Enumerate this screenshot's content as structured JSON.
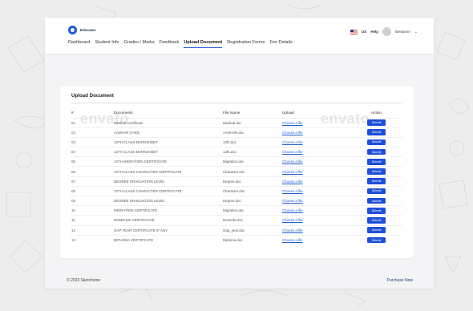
{
  "brand": {
    "name": "Educator"
  },
  "nav": {
    "tabs": [
      {
        "label": "Dashboard",
        "active": false
      },
      {
        "label": "Student Info",
        "active": false
      },
      {
        "label": "Grades / Marks",
        "active": false
      },
      {
        "label": "Feedback",
        "active": false
      },
      {
        "label": "Upload Document",
        "active": true
      },
      {
        "label": "Registration Forms",
        "active": false
      },
      {
        "label": "Fee Details",
        "active": false
      }
    ]
  },
  "topright": {
    "lang": "US",
    "help": "Help",
    "user": "Benjamin"
  },
  "card": {
    "title": "Upload Document",
    "headers": {
      "num": "#",
      "doc": "Documents",
      "file": "File Name",
      "upload": "Upload",
      "action": "Action"
    },
    "rows": [
      {
        "num": "01",
        "doc": "Medical Certificate",
        "file": "Medical.doc",
        "upload": "Choose a file",
        "action": "Submit"
      },
      {
        "num": "02",
        "doc": "AADHAR CARD",
        "file": "AADHAR.doc",
        "upload": "Choose a file",
        "action": "Submit"
      },
      {
        "num": "03",
        "doc": "10TH CLASS MARKSHEET",
        "file": "10th.doc",
        "upload": "Choose a file",
        "action": "Submit"
      },
      {
        "num": "04",
        "doc": "12TH CLASS MARKSHEET",
        "file": "12th.doc",
        "upload": "Choose a file",
        "action": "Submit"
      },
      {
        "num": "05",
        "doc": "12TH MIGRATION CERTIFICATE",
        "file": "Migration.doc",
        "upload": "Choose a file",
        "action": "Submit"
      },
      {
        "num": "06",
        "doc": "10TH CLASS CHARACTER CERTIFICATE",
        "file": "Character.doc",
        "upload": "Choose a file",
        "action": "Submit"
      },
      {
        "num": "07",
        "doc": "DEGREE GRADUATION LEVEL",
        "file": "Degree.doc",
        "upload": "Choose a file",
        "action": "Submit"
      },
      {
        "num": "08",
        "doc": "12TH CLASS CHARACTER CERTIFICATE",
        "file": "Character.doc",
        "upload": "Choose a file",
        "action": "Submit"
      },
      {
        "num": "09",
        "doc": "DEGREE GRADUATION LEVEL",
        "file": "Degree.doc",
        "upload": "Choose a file",
        "action": "Submit"
      },
      {
        "num": "10",
        "doc": "MIGRATION CERTIFICATE",
        "file": "Migration.doc",
        "upload": "Choose a file",
        "action": "Submit"
      },
      {
        "num": "11",
        "doc": "DOMICILE CERTIFICATE",
        "file": "Domicile.doc",
        "upload": "Choose a file",
        "action": "Submit"
      },
      {
        "num": "12",
        "doc": "GAP YEAR CERTIFICATE IF ANY",
        "file": "Gap_year.doc",
        "upload": "Choose a file",
        "action": "Submit"
      },
      {
        "num": "13",
        "doc": "DIPLOMA CERTIFICATE",
        "file": "Diploma.doc",
        "upload": "Choose a file",
        "action": "Submit"
      }
    ]
  },
  "footer": {
    "copyright": "© 2023 Sketchvine",
    "link": "Purchase Now"
  },
  "watermark": {
    "text": "envato"
  },
  "colors": {
    "accent": "#1e4fd8",
    "background": "#ededed",
    "card": "#ffffff"
  }
}
